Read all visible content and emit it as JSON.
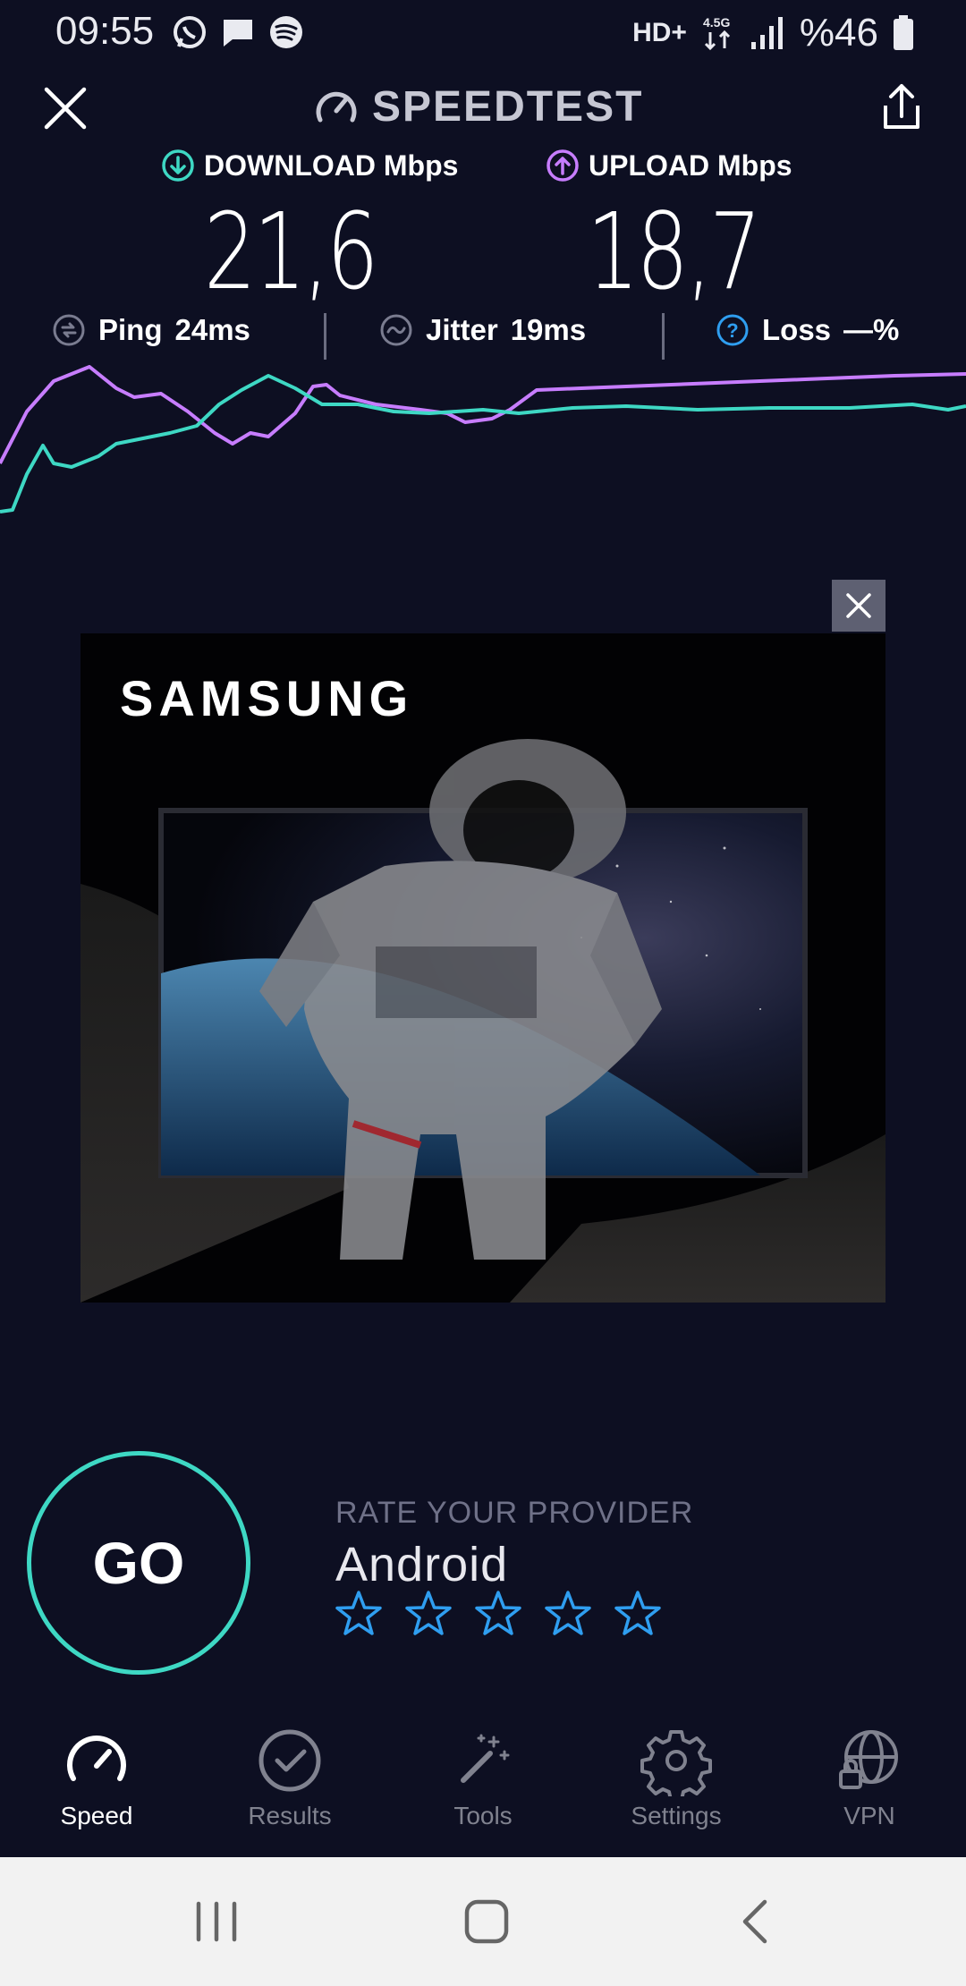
{
  "status_bar": {
    "time": "09:55",
    "network": "HD+",
    "signal_label": "4.5G",
    "battery": "%46",
    "left_icons": [
      "whatsapp-icon",
      "message-icon",
      "spotify-icon"
    ]
  },
  "header": {
    "title": "SPEEDTEST"
  },
  "metrics": {
    "download": {
      "label": "DOWNLOAD Mbps",
      "value": "21,6",
      "color": "#3ed8c4"
    },
    "upload": {
      "label": "UPLOAD Mbps",
      "value": "18,7",
      "color": "#c77dff"
    }
  },
  "stats": {
    "ping": {
      "label": "Ping",
      "value": "24ms"
    },
    "jitter": {
      "label": "Jitter",
      "value": "19ms"
    },
    "loss": {
      "label": "Loss",
      "value": "—%"
    }
  },
  "ad": {
    "brand": "SAMSUNG"
  },
  "go_button": "GO",
  "rating": {
    "label": "RATE YOUR PROVIDER",
    "provider": "Android",
    "stars": 5,
    "star_color": "#2f9ef0"
  },
  "nav": {
    "items": [
      {
        "label": "Speed",
        "icon": "speedometer-icon",
        "active": true
      },
      {
        "label": "Results",
        "icon": "check-circle-icon",
        "active": false
      },
      {
        "label": "Tools",
        "icon": "magic-wand-icon",
        "active": false
      },
      {
        "label": "Settings",
        "icon": "gear-icon",
        "active": false
      },
      {
        "label": "VPN",
        "icon": "globe-lock-icon",
        "active": false
      }
    ]
  },
  "colors": {
    "background": "#0d0f22",
    "accent_teal": "#3ed8c4",
    "accent_purple": "#c77dff"
  }
}
